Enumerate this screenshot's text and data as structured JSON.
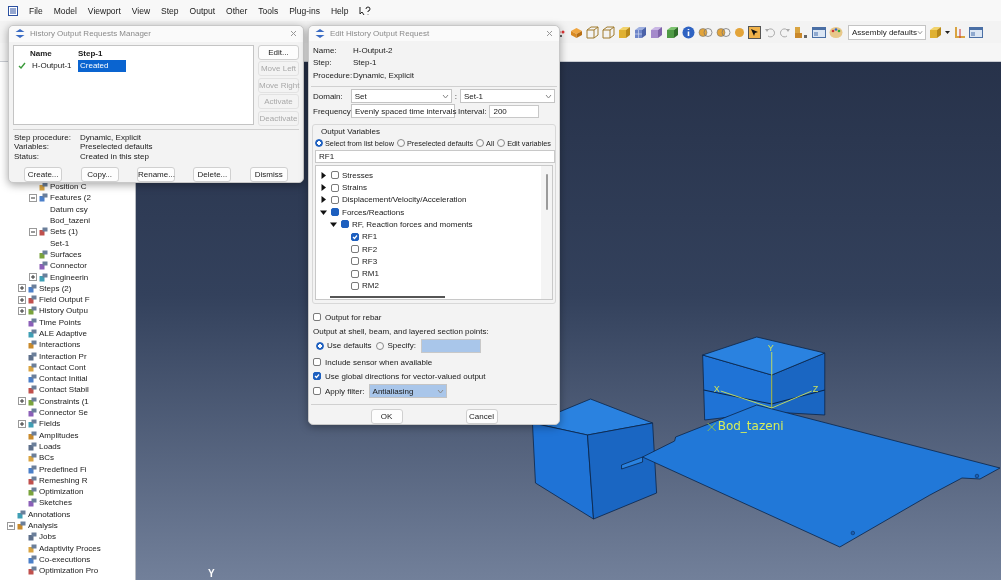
{
  "menu": [
    "File",
    "Model",
    "Viewport",
    "View",
    "Step",
    "Output",
    "Other",
    "Tools",
    "Plug-ins",
    "Help"
  ],
  "toolbar": {
    "render_style": "Assembly defaults"
  },
  "tree": {
    "assembly_items": [
      {
        "label": "Position C"
      },
      {
        "label": "Features (2",
        "expanded": true,
        "children": [
          {
            "label": "Datum csy",
            "kind": "entry"
          },
          {
            "label": "Bod_tazeni",
            "kind": "entry"
          }
        ]
      },
      {
        "label": "Sets (1)",
        "expanded": true,
        "children": [
          {
            "label": "Set-1",
            "kind": "entry"
          }
        ]
      },
      {
        "label": "Surfaces"
      },
      {
        "label": "Connector"
      },
      {
        "label": "Engineerin",
        "expanded": false
      }
    ],
    "model_items": [
      {
        "label": "Steps (2)",
        "expanded": false
      },
      {
        "label": "Field Output F",
        "expanded": false
      },
      {
        "label": "History Outpu",
        "expanded": false
      },
      {
        "label": "Time Points"
      },
      {
        "label": "ALE Adaptive"
      },
      {
        "label": "Interactions"
      },
      {
        "label": "Interaction Pr"
      },
      {
        "label": "Contact Cont"
      },
      {
        "label": "Contact Initial"
      },
      {
        "label": "Contact Stabil"
      },
      {
        "label": "Constraints (1",
        "expanded": false
      },
      {
        "label": "Connector Se"
      },
      {
        "label": "Fields",
        "expanded": false
      },
      {
        "label": "Amplitudes"
      },
      {
        "label": "Loads"
      },
      {
        "label": "BCs"
      },
      {
        "label": "Predefined Fi"
      },
      {
        "label": "Remeshing R"
      },
      {
        "label": "Optimization"
      },
      {
        "label": "Sketches"
      }
    ],
    "root_items": [
      {
        "label": "Annotations"
      },
      {
        "label": "Analysis",
        "expanded": true,
        "children": [
          {
            "label": "Jobs"
          },
          {
            "label": "Adaptivity Proces"
          },
          {
            "label": "Co-executions"
          },
          {
            "label": "Optimization Pro"
          }
        ]
      }
    ]
  },
  "manager": {
    "title": "History Output Requests Manager",
    "columns": [
      "Name",
      "Step-1"
    ],
    "rows": [
      {
        "active": true,
        "name": "H-Output-1",
        "step_1": "Created",
        "selected": true
      }
    ],
    "side_buttons": [
      {
        "label": "Edit...",
        "disabled": false
      },
      {
        "label": "Move Left",
        "disabled": true
      },
      {
        "label": "Move Right",
        "disabled": true
      },
      {
        "label": "Activate",
        "disabled": true
      },
      {
        "label": "Deactivate",
        "disabled": true
      }
    ],
    "info": [
      {
        "label": "Step procedure:",
        "value": "Dynamic, Explicit"
      },
      {
        "label": "Variables:",
        "value": "Preselected defaults"
      },
      {
        "label": "Status:",
        "value": "Created in this step"
      }
    ],
    "buttons": [
      "Create...",
      "Copy...",
      "Rename...",
      "Delete...",
      "Dismiss"
    ]
  },
  "editor": {
    "title": "Edit History Output Request",
    "fields": [
      {
        "label": "Name:",
        "value": "H-Output-2"
      },
      {
        "label": "Step:",
        "value": "Step-1"
      },
      {
        "label": "Procedure:",
        "value": "Dynamic, Explicit"
      }
    ],
    "domain": {
      "label": "Domain:",
      "value": "Set",
      "separator": ":",
      "set": "Set-1"
    },
    "frequency": {
      "label": "Frequency:",
      "value": "Evenly spaced time intervals",
      "interval_label": "Interval:",
      "interval": "200"
    },
    "output_variables": {
      "title": "Output Variables",
      "modes": [
        {
          "label": "Select from list below",
          "selected": true
        },
        {
          "label": "Preselected defaults",
          "selected": false
        },
        {
          "label": "All",
          "selected": false
        },
        {
          "label": "Edit variables",
          "selected": false
        }
      ],
      "filter": "RF1",
      "variables": [
        {
          "label": "Stresses",
          "checked": false,
          "partial": false,
          "expanded": false
        },
        {
          "label": "Strains",
          "checked": false,
          "partial": false,
          "expanded": false
        },
        {
          "label": "Displacement/Velocity/Acceleration",
          "checked": false,
          "partial": false,
          "expanded": false
        },
        {
          "label": "Forces/Reactions",
          "checked": false,
          "partial": true,
          "expanded": true,
          "children": [
            {
              "label": "RF, Reaction forces and moments",
              "checked": false,
              "partial": true,
              "expanded": true,
              "children": [
                {
                  "label": "RF1",
                  "checked": true
                },
                {
                  "label": "RF2",
                  "checked": false
                },
                {
                  "label": "RF3",
                  "checked": false
                },
                {
                  "label": "RM1",
                  "checked": false
                },
                {
                  "label": "RM2",
                  "checked": false
                }
              ]
            }
          ]
        }
      ]
    },
    "rebar": {
      "label": "Output for rebar",
      "checked": false
    },
    "section_points": {
      "label": "Output at shell, beam, and layered section points:",
      "options": [
        {
          "label": "Use defaults",
          "selected": true
        },
        {
          "label": "Specify:",
          "selected": false
        }
      ]
    },
    "options": [
      {
        "label": "Include sensor when available",
        "checked": false
      },
      {
        "label": "Use global directions for vector-valued output",
        "checked": true
      }
    ],
    "filter": {
      "label": "Apply filter:",
      "checked": false,
      "value": "Antialiasing"
    },
    "buttons": [
      "OK",
      "Cancel"
    ]
  },
  "viewport": {
    "point_label": "Bod_tazeni",
    "axes": [
      "Y",
      "X",
      "Z"
    ],
    "triad_label": "Y"
  }
}
